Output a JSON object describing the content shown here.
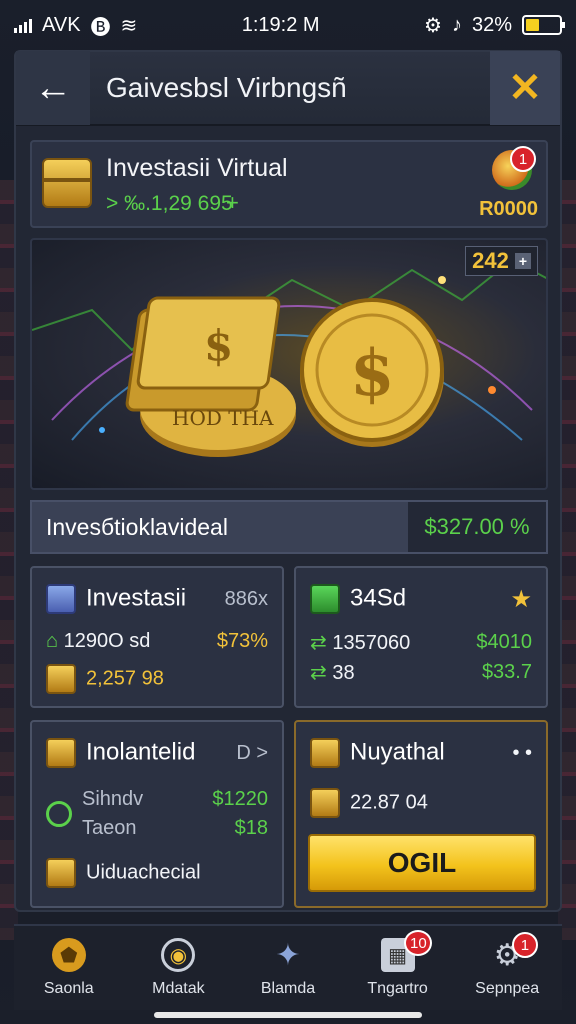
{
  "status": {
    "carrier": "AVK",
    "time": "1:19:2 M",
    "battery": "32%"
  },
  "header": {
    "title": "Gaivesbsl Virbngsñ"
  },
  "investment": {
    "title": "Investasii Virtual",
    "sub": "> ‰.1,29 695",
    "plus": "+",
    "tag": "R0000",
    "notif": "1"
  },
  "hero": {
    "counter": "242",
    "coin_text": "HOD THA"
  },
  "summary": {
    "label": "Invesбtioklavideal",
    "value": "$327.00 %"
  },
  "card_a": {
    "title": "Investasii",
    "badge": "886x",
    "row1_label": "1290O sd",
    "row1_value": "$73%",
    "row2_label": "2,257 98"
  },
  "card_b": {
    "title": "34Sd",
    "row1_label": "1357060",
    "row1_value": "$4010",
    "row2_label": "38",
    "row2_value": "$33.7"
  },
  "card_c": {
    "title": "Inolantelid",
    "badge": "D >",
    "mid_label1": "Sihndv",
    "mid_label2": "Taeon",
    "mid_value1": "$1220",
    "mid_value2": "$18",
    "bottom": "Uiduachecial"
  },
  "card_d": {
    "title": "Nuyathal",
    "dots": "• •",
    "row_value": "22.87 04",
    "cta": "OGIL"
  },
  "nav": {
    "items": [
      {
        "label": "Saonla"
      },
      {
        "label": "Mdatak"
      },
      {
        "label": "Blamda"
      },
      {
        "label": "Tngartro",
        "badge": "10"
      },
      {
        "label": "Sepnpea",
        "badge": "1"
      }
    ]
  },
  "colors": {
    "accent_gold": "#f2c23a",
    "accent_green": "#5bd14b",
    "close_x": "#f2b621"
  },
  "icons": [
    "back-arrow-icon",
    "close-icon",
    "chest-icon",
    "coin-icon",
    "star-icon",
    "home-icon",
    "map-icon",
    "star-nav-icon",
    "calendar-icon",
    "settings-icon"
  ]
}
